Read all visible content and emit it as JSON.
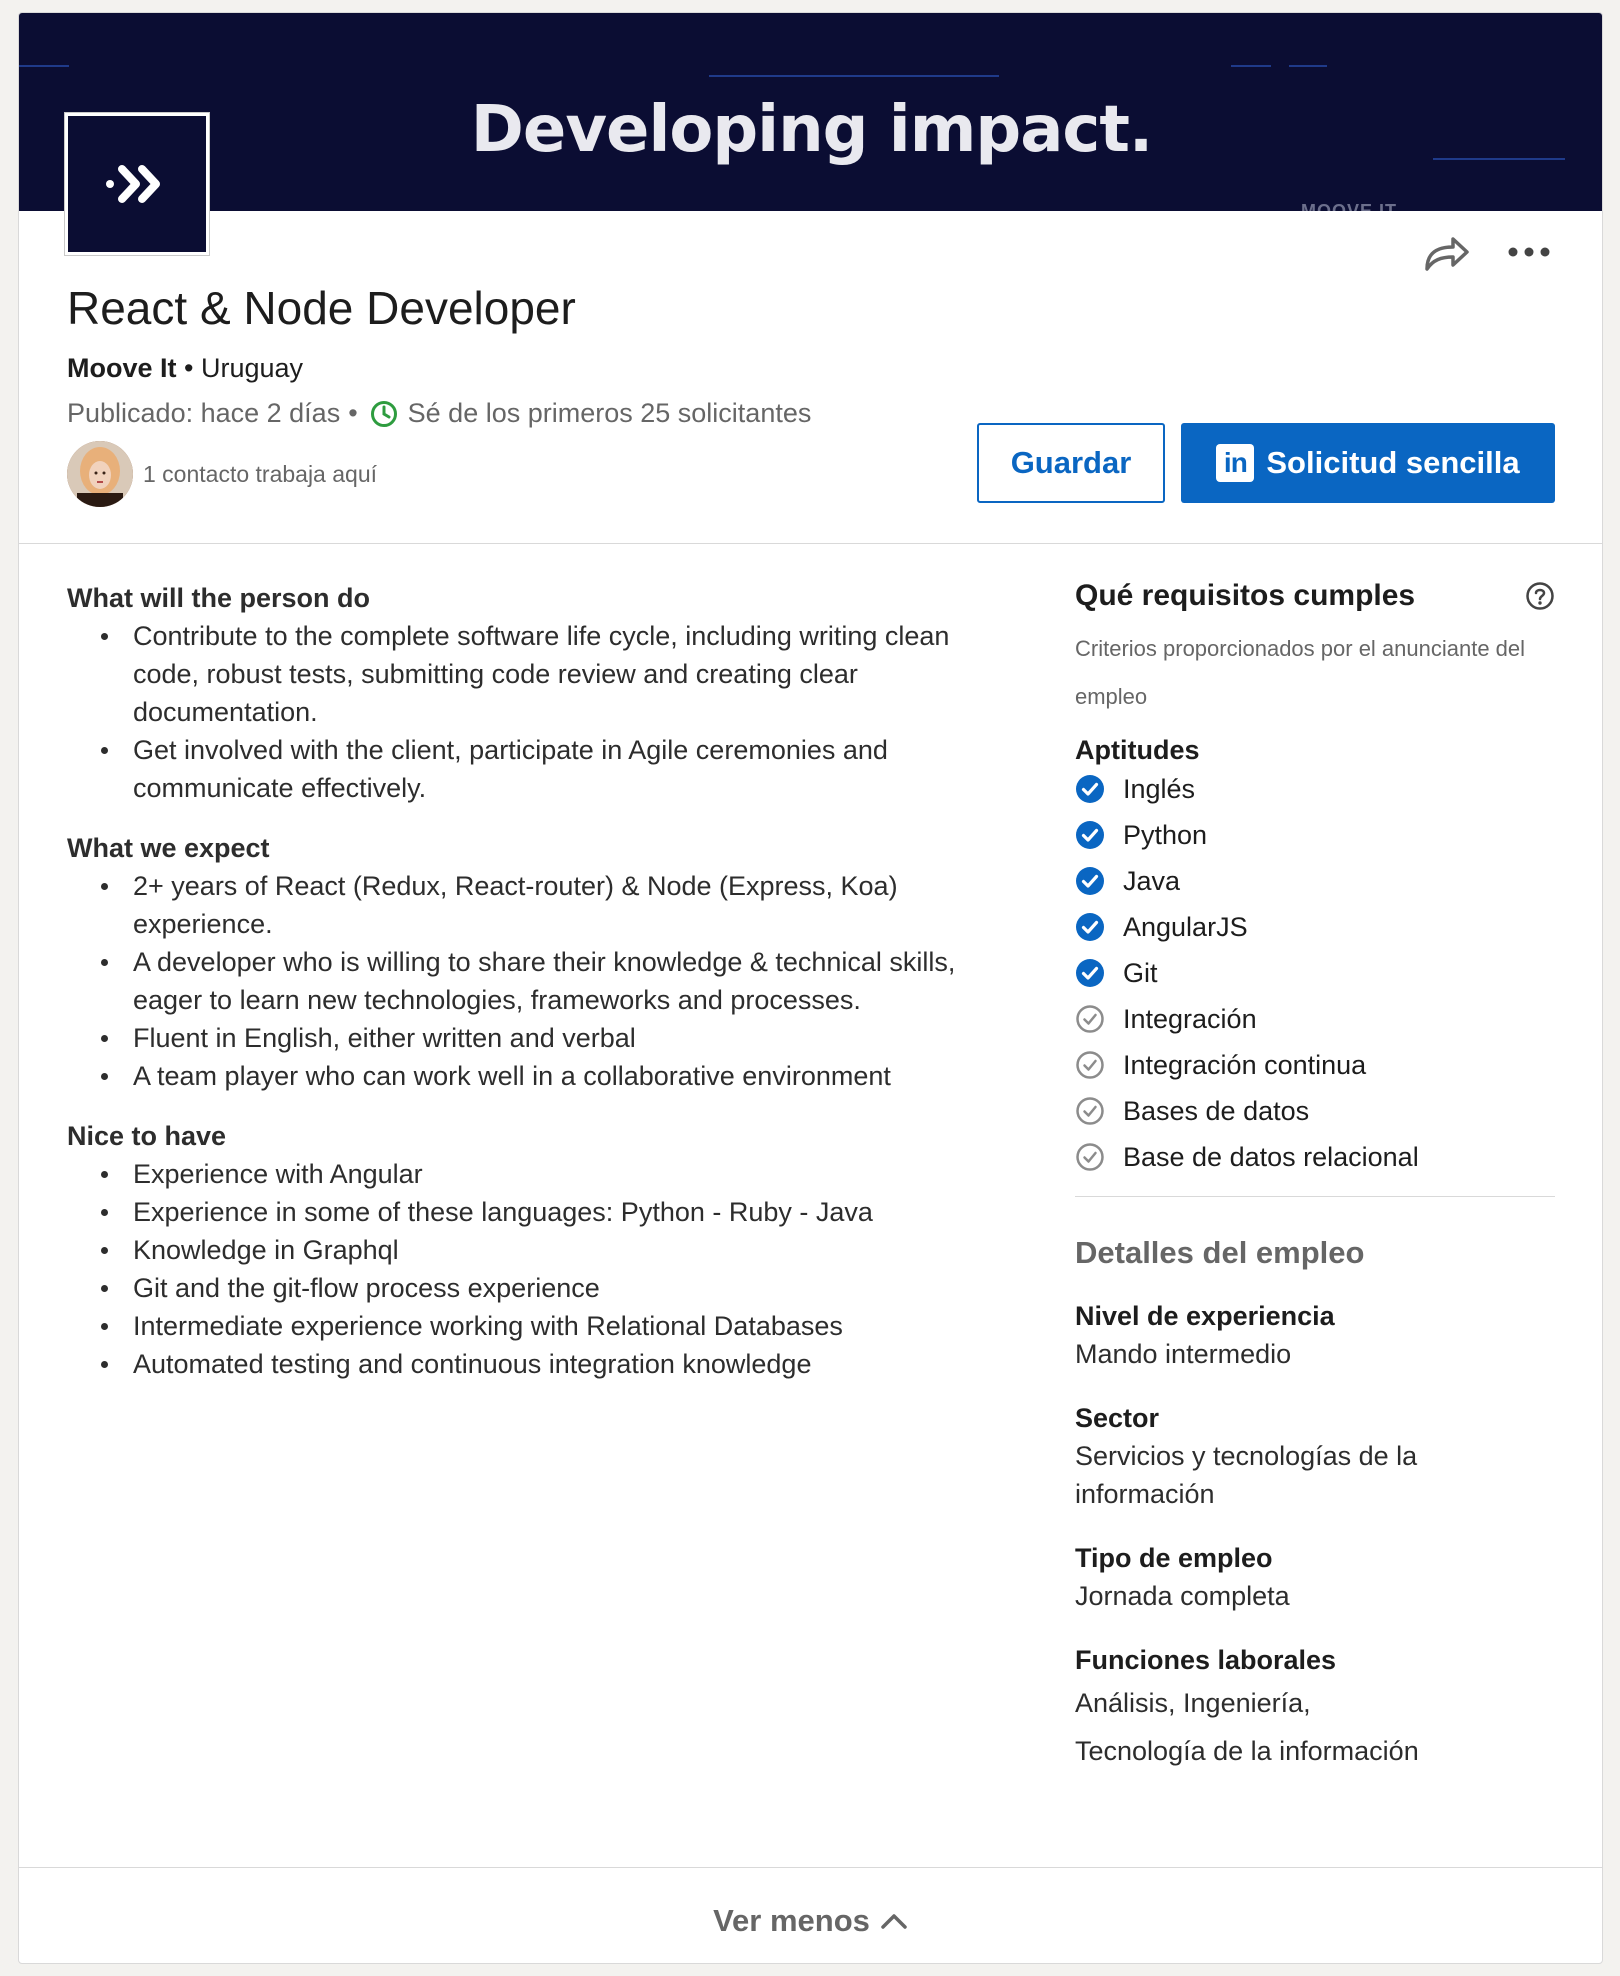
{
  "banner": {
    "tagline": "Developing impact.",
    "watermark": "MOOVE IT",
    "logo_icon": "moove-it-logo",
    "bg_color": "#0b0d33"
  },
  "header": {
    "share_icon": "share-arrow-icon",
    "more_icon": "more-horizontal-icon"
  },
  "job": {
    "title": "React & Node Developer",
    "company": "Moove It",
    "location": "Uruguay",
    "posted": "Publicado: hace 2 días",
    "applicants": "Sé de los primeros 25 solicitantes",
    "contacts": "1 contacto trabaja aquí"
  },
  "actions": {
    "save_label": "Guardar",
    "apply_label": "Solicitud sencilla",
    "apply_logo": "in"
  },
  "description": {
    "sections": [
      {
        "heading": "What will the person do",
        "items": [
          "Contribute to the complete software life cycle, including writing clean code, robust tests, submitting code review and creating clear documentation.",
          "Get involved with the client, participate in Agile ceremonies and communicate effectively."
        ]
      },
      {
        "heading": "What we expect",
        "items": [
          "2+ years of React (Redux, React-router) & Node (Express, Koa) experience.",
          "A developer who is willing to share their knowledge & technical skills, eager to learn new technologies, frameworks and processes.",
          "Fluent in English, either written and verbal",
          "A team player who can work well in a collaborative environment"
        ]
      },
      {
        "heading": "Nice to have",
        "items": [
          "Experience with Angular",
          "Experience in some of these languages: Python - Ruby - Java",
          "Knowledge in Graphql",
          "Git and the git-flow process experience",
          "Intermediate experience working with Relational Databases",
          "Automated testing and continuous integration knowledge"
        ]
      }
    ]
  },
  "requirements": {
    "title": "Qué requisitos cumples",
    "subtitle": "Criterios proporcionados por el anunciante del empleo",
    "skills_title": "Aptitudes",
    "skills": [
      {
        "name": "Inglés",
        "matched": true
      },
      {
        "name": "Python",
        "matched": true
      },
      {
        "name": "Java",
        "matched": true
      },
      {
        "name": "AngularJS",
        "matched": true
      },
      {
        "name": "Git",
        "matched": true
      },
      {
        "name": "Integración",
        "matched": false
      },
      {
        "name": "Integración continua",
        "matched": false
      },
      {
        "name": "Bases de datos",
        "matched": false
      },
      {
        "name": "Base de datos relacional",
        "matched": false
      }
    ]
  },
  "details": {
    "title": "Detalles del empleo",
    "experience_label": "Nivel de experiencia",
    "experience_value": "Mando intermedio",
    "sector_label": "Sector",
    "sector_value": "Servicios y tecnologías de la información",
    "type_label": "Tipo de empleo",
    "type_value": "Jornada completa",
    "functions_label": "Funciones laborales",
    "functions_line1": "Análisis, Ingeniería,",
    "functions_line2": "Tecnología de la información"
  },
  "footer": {
    "see_less": "Ver menos"
  },
  "colors": {
    "accent": "#0a66c2",
    "green": "#2e9c3f",
    "muted": "#666666"
  }
}
